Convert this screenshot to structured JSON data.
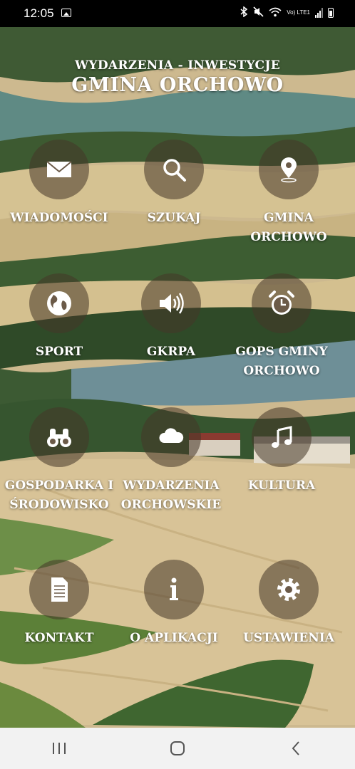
{
  "status_bar": {
    "time": "12:05",
    "network_label": "Vo) LTE1",
    "icons": [
      "image-icon",
      "bluetooth-icon",
      "mute-icon",
      "wifi-icon",
      "signal-icon",
      "battery-icon"
    ]
  },
  "header": {
    "subtitle": "WYDARZENIA - INWESTYCJE",
    "title": "GMINA ORCHOWO"
  },
  "tiles": [
    {
      "label": "WIADOMOŚCI",
      "icon": "envelope-icon"
    },
    {
      "label": "SZUKAJ",
      "icon": "search-icon"
    },
    {
      "label": "GMINA ORCHOWO",
      "icon": "location-pin-icon"
    },
    {
      "label": "SPORT",
      "icon": "globe-icon"
    },
    {
      "label": "GKRPA",
      "icon": "speaker-icon"
    },
    {
      "label": "GOPS GMINY ORCHOWO",
      "icon": "alarm-clock-icon"
    },
    {
      "label": "GOSPODARKA I ŚRODOWISKO",
      "icon": "binoculars-icon"
    },
    {
      "label": "WYDARZENIA ORCHOWSKIE",
      "icon": "cloud-icon"
    },
    {
      "label": "KULTURA",
      "icon": "music-note-icon"
    },
    {
      "label": "KONTAKT",
      "icon": "document-icon"
    },
    {
      "label": "O APLIKACJI",
      "icon": "info-icon"
    },
    {
      "label": "USTAWIENIA",
      "icon": "gear-icon"
    }
  ],
  "nav_bar": {
    "buttons": [
      "recent-apps-icon",
      "home-icon",
      "back-icon"
    ]
  },
  "colors": {
    "tile_circle": "#463728",
    "text": "#ffffff",
    "nav_background": "#f2f2f2"
  }
}
